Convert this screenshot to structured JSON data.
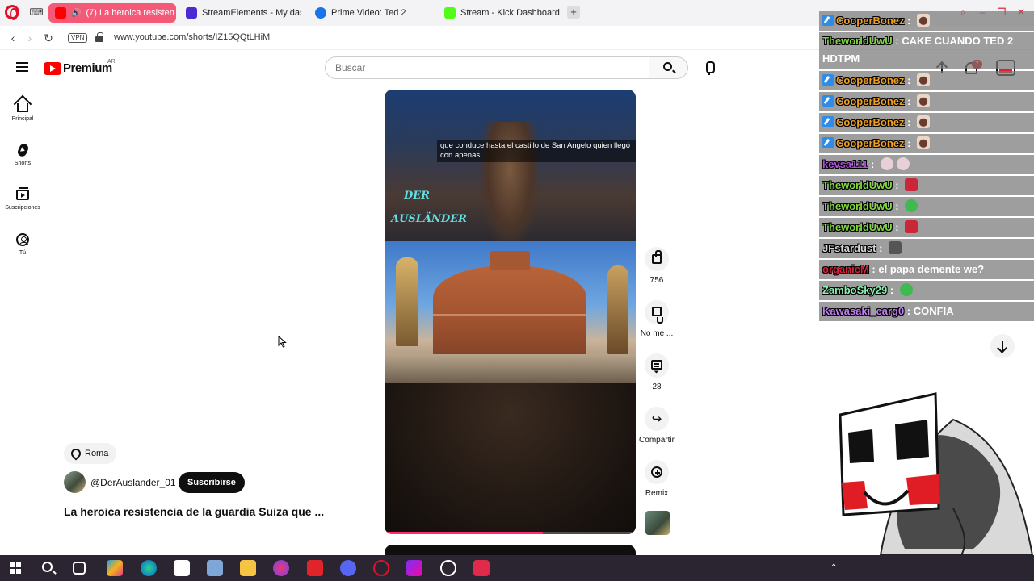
{
  "browser": {
    "tabs": [
      {
        "label": "(7) La heroica resisten",
        "active": true,
        "color": "#f45a78"
      },
      {
        "label": "StreamElements - My das",
        "active": false,
        "color": "#4b2ad6"
      },
      {
        "label": "Prime Video: Ted 2",
        "active": false,
        "color": "#1a73e8"
      },
      {
        "label": "Stream - Kick Dashboard",
        "active": false,
        "color": "#53fc18"
      }
    ],
    "new_tab": "+",
    "vpn": "VPN",
    "url": "www.youtube.com/shorts/IZ15QQtLHiM"
  },
  "youtube": {
    "brand": "Premium",
    "region": "AR",
    "search_placeholder": "Buscar",
    "notifications": "7",
    "sidebar": [
      {
        "label": "Principal",
        "icon": "home-icon"
      },
      {
        "label": "Shorts",
        "icon": "shorts-icon"
      },
      {
        "label": "Suscripciones",
        "icon": "subscriptions-icon"
      },
      {
        "label": "Tú",
        "icon": "you-icon"
      }
    ]
  },
  "short": {
    "subtitle": "que conduce hasta el castillo de San Angelo quien llegó con apenas",
    "watermark_line1": "DER",
    "watermark_line2": "AUSLÄNDER",
    "progress": 0.63,
    "actions": {
      "like_count": "756",
      "dislike_label": "No me ...",
      "comment_count": "28",
      "share_label": "Compartir",
      "remix_label": "Remix"
    },
    "location": "Roma",
    "channel": "@DerAuslander_01",
    "subscribe_label": "Suscribirse",
    "title": "La heroica resistencia de la guardia Suiza que ..."
  },
  "chat": [
    {
      "user": "CooperBonez",
      "color": "#f0a020",
      "badge": true,
      "message": "",
      "emote": "dog"
    },
    {
      "user": "TheworldUwU",
      "color": "#7ddc3c",
      "badge": false,
      "message": "CAKE CUANDO TED 2 HDTPM",
      "emote": ""
    },
    {
      "user": "CooperBonez",
      "color": "#f0a020",
      "badge": true,
      "message": "",
      "emote": "dog"
    },
    {
      "user": "CooperBonez",
      "color": "#f0a020",
      "badge": true,
      "message": "",
      "emote": "dog"
    },
    {
      "user": "CooperBonez",
      "color": "#f0a020",
      "badge": true,
      "message": "",
      "emote": "dog"
    },
    {
      "user": "CooperBonez",
      "color": "#f0a020",
      "badge": true,
      "message": "",
      "emote": "dog"
    },
    {
      "user": "kevsa111",
      "color": "#b050e0",
      "badge": false,
      "message": "",
      "emote": "face"
    },
    {
      "user": "TheworldUwU",
      "color": "#7ddc3c",
      "badge": false,
      "message": "",
      "emote": "red"
    },
    {
      "user": "TheworldUwU",
      "color": "#7ddc3c",
      "badge": false,
      "message": "",
      "emote": "green"
    },
    {
      "user": "TheworldUwU",
      "color": "#7ddc3c",
      "badge": false,
      "message": "",
      "emote": "red"
    },
    {
      "user": "JFstardust",
      "color": "#d6d6d6",
      "badge": false,
      "message": "",
      "emote": "dark"
    },
    {
      "user": "organicM",
      "color": "#e0203a",
      "badge": false,
      "message": "el papa demente we?",
      "emote": ""
    },
    {
      "user": "ZamboSky29",
      "color": "#8cf0b0",
      "badge": false,
      "message": "",
      "emote": "green"
    },
    {
      "user": "Kawasaki_carg0",
      "color": "#c080f0",
      "badge": false,
      "message": "CONFIA",
      "emote": ""
    }
  ]
}
